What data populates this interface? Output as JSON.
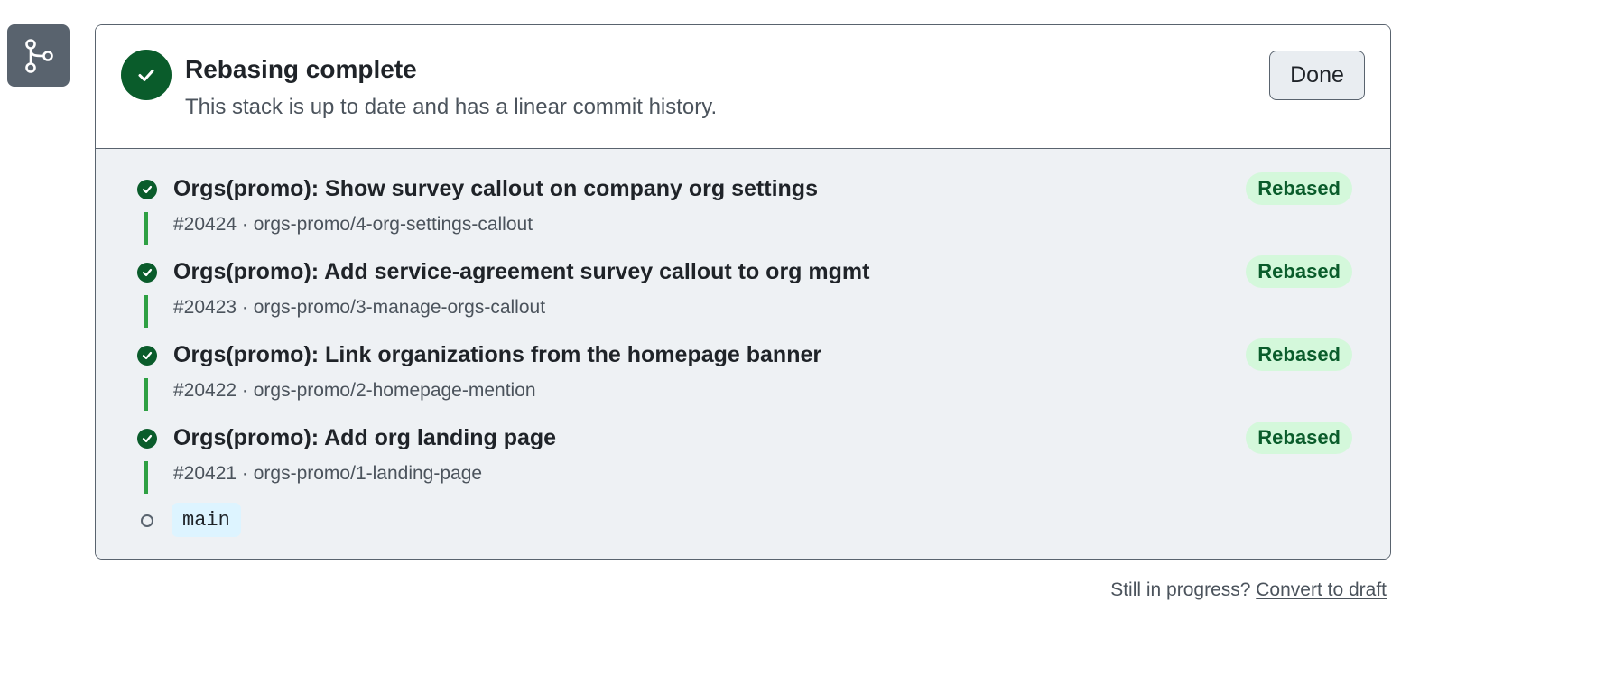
{
  "sidebar": {
    "icon": "git-branch-icon"
  },
  "header": {
    "title": "Rebasing complete",
    "subtitle": "This stack is up to date and has a linear commit history.",
    "done_label": "Done",
    "status_icon": "check-circle-icon"
  },
  "commits": [
    {
      "title": "Orgs(promo): Show survey callout on company org settings",
      "meta": "#20424 · orgs-promo/4-org-settings-callout",
      "status": "Rebased"
    },
    {
      "title": "Orgs(promo): Add service-agreement survey callout to org mgmt",
      "meta": "#20423 · orgs-promo/3-manage-orgs-callout",
      "status": "Rebased"
    },
    {
      "title": "Orgs(promo): Link organizations from the homepage banner",
      "meta": "#20422 · orgs-promo/2-homepage-mention",
      "status": "Rebased"
    },
    {
      "title": "Orgs(promo): Add org landing page",
      "meta": "#20421 · orgs-promo/1-landing-page",
      "status": "Rebased"
    }
  ],
  "base": {
    "branch": "main"
  },
  "footer": {
    "prompt": "Still in progress?",
    "convert_label": "Convert to draft"
  },
  "colors": {
    "success": "#0a5c2b",
    "connector": "#2ea043",
    "badge_bg": "#d4f8db",
    "body_bg": "#eef1f4",
    "branch_bg": "#ddf4ff"
  }
}
